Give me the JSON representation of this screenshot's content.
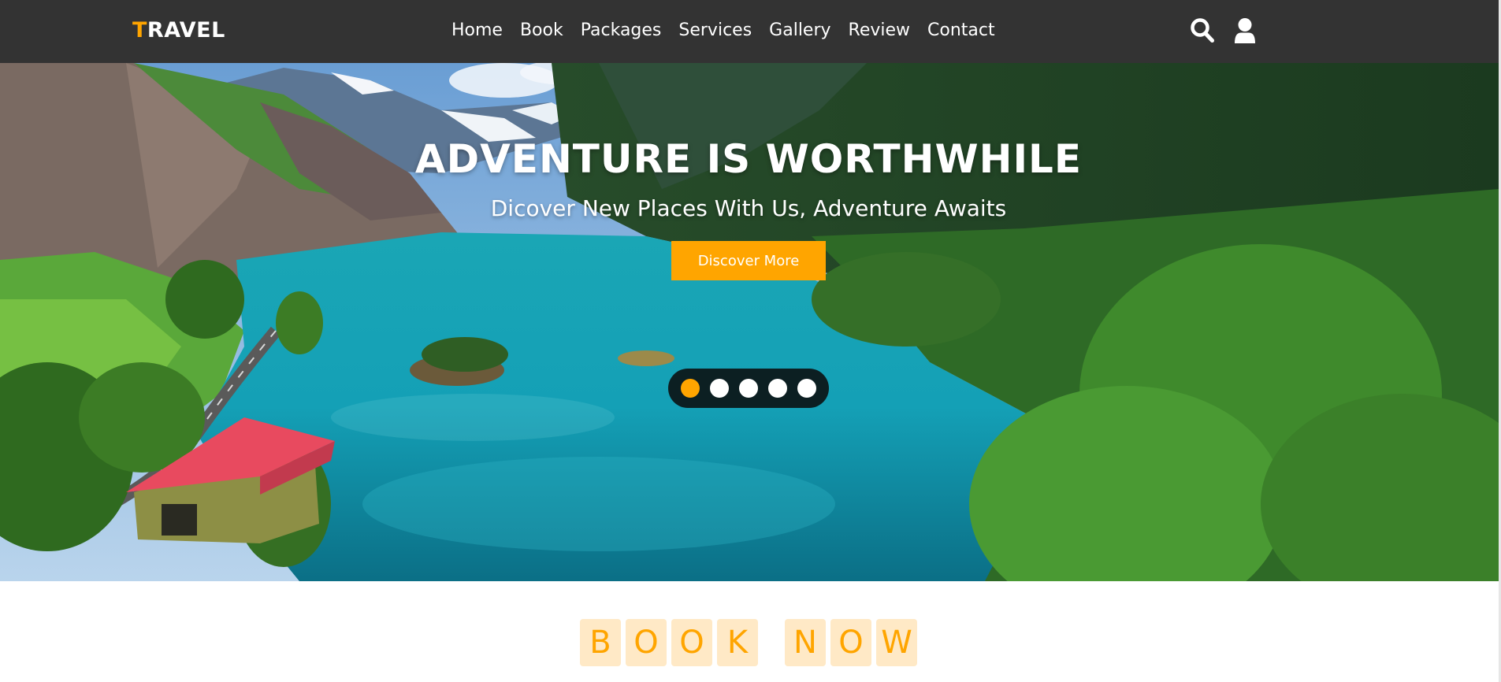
{
  "header": {
    "logo_first": "T",
    "logo_rest": "RAVEL",
    "nav": [
      "Home",
      "Book",
      "Packages",
      "Services",
      "Gallery",
      "Review",
      "Contact"
    ],
    "icons": [
      "search-icon",
      "user-icon"
    ]
  },
  "hero": {
    "title": "ADVENTURE IS WORTHWHILE",
    "subtitle": "Dicover New Places With Us, Adventure Awaits",
    "button": "Discover More",
    "slide_count": 5,
    "active_slide": 1
  },
  "book": {
    "word1": [
      "B",
      "O",
      "O",
      "K"
    ],
    "word2": [
      "N",
      "O",
      "W"
    ]
  },
  "colors": {
    "accent": "#ffa500",
    "header_bg": "#333333",
    "letter_bg": "#ffe9c6"
  }
}
